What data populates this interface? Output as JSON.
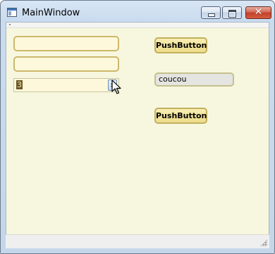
{
  "window": {
    "title": "MainWindow"
  },
  "titlebar_buttons": {
    "close_glyph": "✕"
  },
  "form": {
    "line_edit_1_value": "",
    "line_edit_2_value": "",
    "spinbox_value": "3",
    "push_button_1_label": "PushButton",
    "label_text": "coucou",
    "push_button_2_label": "PushButton"
  },
  "icons": {
    "app": "window-icon",
    "cursor": "arrow-cursor"
  },
  "colors": {
    "client_background": "#f7f7df",
    "field_border": "#cdb86a",
    "button_fill": "#ecdc8a"
  }
}
